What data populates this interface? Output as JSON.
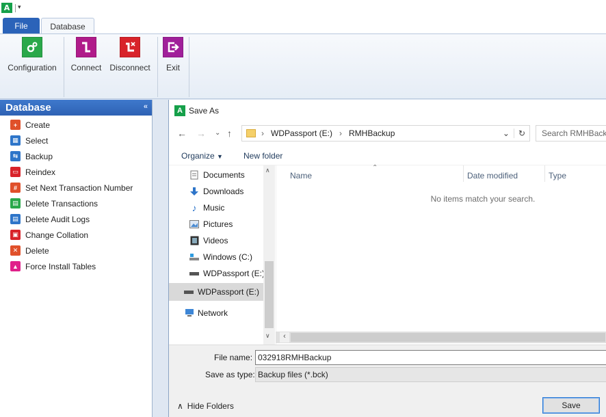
{
  "app": {
    "logo_text": "A"
  },
  "tabs": [
    {
      "label": "File"
    },
    {
      "label": "Database"
    }
  ],
  "ribbon": {
    "buttons": [
      {
        "label": "Configuration",
        "icon": "gears-icon",
        "color": "#2aa84a"
      },
      {
        "label": "Connect",
        "icon": "connect-icon",
        "color": "#b01b8a"
      },
      {
        "label": "Disconnect",
        "icon": "disconnect-icon",
        "color": "#d8232a"
      },
      {
        "label": "Exit",
        "icon": "exit-icon",
        "color": "#a0209a"
      }
    ]
  },
  "left_panel": {
    "title": "Database",
    "items": [
      {
        "label": "Create",
        "icon": "create-icon",
        "color": "#e0502a"
      },
      {
        "label": "Select",
        "icon": "select-icon",
        "color": "#2e75c9"
      },
      {
        "label": "Backup",
        "icon": "backup-icon",
        "color": "#2e75c9"
      },
      {
        "label": "Reindex",
        "icon": "reindex-icon",
        "color": "#d8232a"
      },
      {
        "label": "Set Next Transaction Number",
        "icon": "transaction-number-icon",
        "color": "#e0502a"
      },
      {
        "label": "Delete Transactions",
        "icon": "delete-transactions-icon",
        "color": "#2aa84a"
      },
      {
        "label": "Delete Audit Logs",
        "icon": "delete-audit-logs-icon",
        "color": "#2e75c9"
      },
      {
        "label": "Change Collation",
        "icon": "change-collation-icon",
        "color": "#d8232a"
      },
      {
        "label": "Delete",
        "icon": "delete-icon",
        "color": "#e0502a"
      },
      {
        "label": "Force Install Tables",
        "icon": "force-install-icon",
        "color": "#e0208a"
      }
    ]
  },
  "dialog": {
    "title": "Save As",
    "breadcrumb": [
      "WDPassport (E:)",
      "RMHBackup"
    ],
    "search_placeholder": "Search RMHBackup",
    "toolbar": {
      "organize": "Organize",
      "new_folder": "New folder"
    },
    "nav_items": [
      {
        "label": "Documents",
        "icon": "documents-icon"
      },
      {
        "label": "Downloads",
        "icon": "downloads-icon"
      },
      {
        "label": "Music",
        "icon": "music-icon"
      },
      {
        "label": "Pictures",
        "icon": "pictures-icon"
      },
      {
        "label": "Videos",
        "icon": "videos-icon"
      },
      {
        "label": "Windows (C:)",
        "icon": "windows-drive-icon"
      },
      {
        "label": "WDPassport (E:)",
        "icon": "drive-icon"
      },
      {
        "label": "WDPassport (E:)",
        "icon": "drive-icon"
      },
      {
        "label": "Network",
        "icon": "network-icon"
      }
    ],
    "columns": [
      "Name",
      "Date modified",
      "Type"
    ],
    "empty_message": "No items match your search.",
    "file_name_label": "File name:",
    "file_name_value": "032918RMHBackup",
    "save_type_label": "Save as type:",
    "save_type_value": "Backup files (*.bck)",
    "hide_folders": "Hide Folders",
    "save_button": "Save"
  }
}
